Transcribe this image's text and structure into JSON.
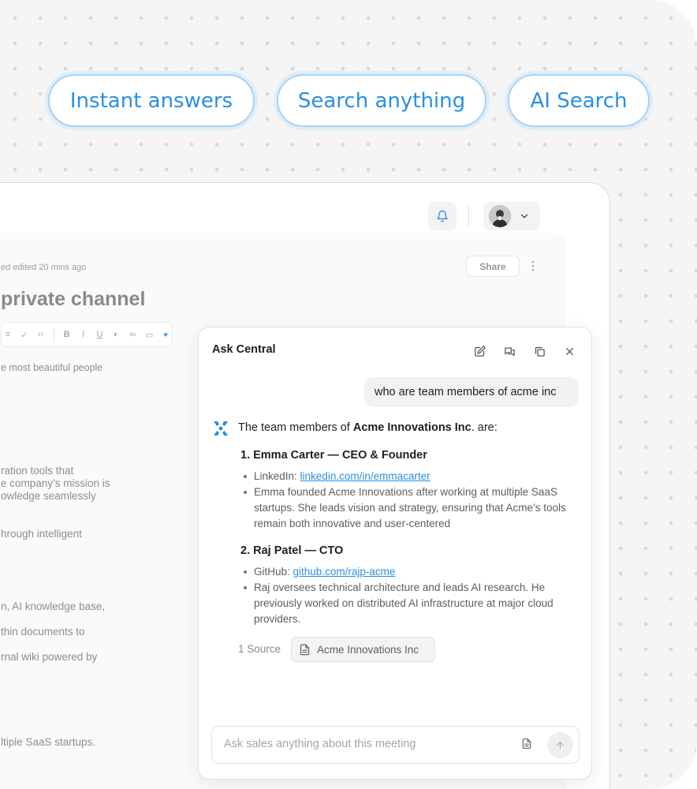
{
  "pills": [
    "Instant answers",
    "Search anything",
    "AI Search"
  ],
  "header": {
    "bell_icon": "bell-icon",
    "avatar": "user-avatar",
    "chevron": "chevron-down-icon"
  },
  "document": {
    "meta": "ed edited 20 mins ago",
    "share_label": "Share",
    "title": "private channel",
    "lines": [
      "e most beautiful people",
      "ration tools that",
      "e company’s mission is",
      "owledge seamlessly",
      "hrough intelligent",
      "n, AI knowledge base,",
      "thin documents to",
      "rnal wiki powered by",
      "ltiple SaaS startups."
    ]
  },
  "chat": {
    "title": "Ask Central",
    "user_message": "who are team members of acme inc",
    "ai_intro_prefix": "The team members of ",
    "ai_intro_company": "Acme Innovations Inc",
    "ai_intro_suffix": ". are:",
    "members": [
      {
        "name": "1. Emma Carter — CEO & Founder",
        "link_label": "LinkedIn: ",
        "link_text": "linkedin.com/in/emmacarter",
        "bio": "Emma founded Acme Innovations after working at multiple SaaS startups.  She leads vision and strategy, ensuring that Acme’s tools remain both innovative and user-centered"
      },
      {
        "name": "2. Raj Patel — CTO",
        "link_label": "GitHub: ",
        "link_text": "github.com/rajp-acme",
        "bio": "Raj oversees technical architecture and leads AI research.  He previously worked on distributed AI infrastructure at major cloud providers."
      }
    ],
    "source_count": "1 Source",
    "source_name": "Acme Innovations Inc",
    "composer_placeholder": "Ask sales anything about this meeting"
  },
  "colors": {
    "accent": "#2b8fe0",
    "pill_border": "#a8d2f5"
  }
}
